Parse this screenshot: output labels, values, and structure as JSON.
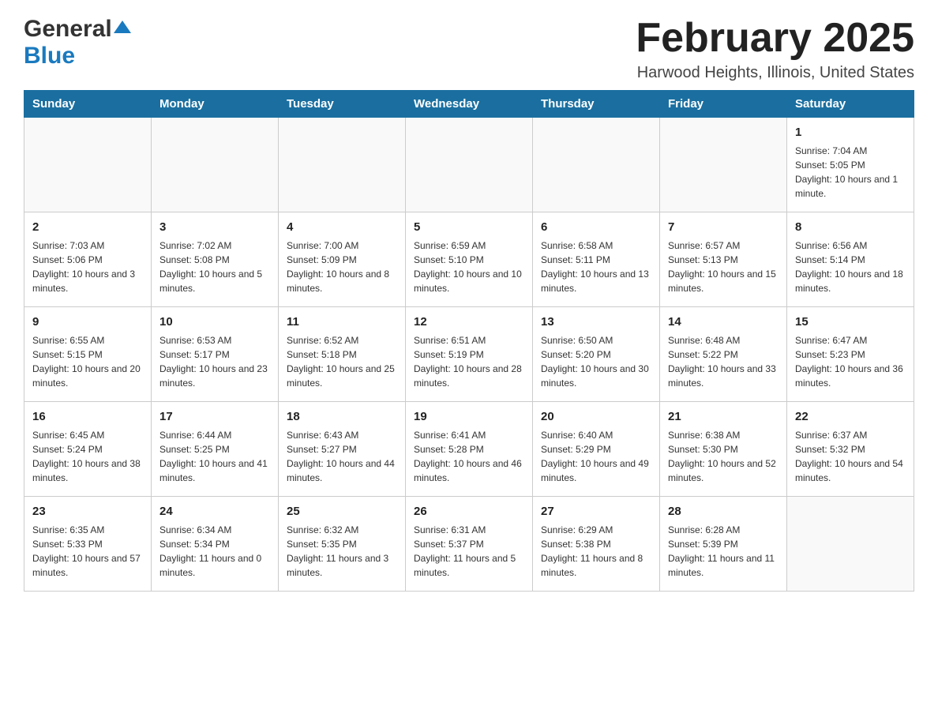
{
  "logo": {
    "general": "General",
    "blue": "Blue"
  },
  "header": {
    "title": "February 2025",
    "subtitle": "Harwood Heights, Illinois, United States"
  },
  "days_of_week": [
    "Sunday",
    "Monday",
    "Tuesday",
    "Wednesday",
    "Thursday",
    "Friday",
    "Saturday"
  ],
  "weeks": [
    [
      {
        "day": "",
        "info": ""
      },
      {
        "day": "",
        "info": ""
      },
      {
        "day": "",
        "info": ""
      },
      {
        "day": "",
        "info": ""
      },
      {
        "day": "",
        "info": ""
      },
      {
        "day": "",
        "info": ""
      },
      {
        "day": "1",
        "info": "Sunrise: 7:04 AM\nSunset: 5:05 PM\nDaylight: 10 hours and 1 minute."
      }
    ],
    [
      {
        "day": "2",
        "info": "Sunrise: 7:03 AM\nSunset: 5:06 PM\nDaylight: 10 hours and 3 minutes."
      },
      {
        "day": "3",
        "info": "Sunrise: 7:02 AM\nSunset: 5:08 PM\nDaylight: 10 hours and 5 minutes."
      },
      {
        "day": "4",
        "info": "Sunrise: 7:00 AM\nSunset: 5:09 PM\nDaylight: 10 hours and 8 minutes."
      },
      {
        "day": "5",
        "info": "Sunrise: 6:59 AM\nSunset: 5:10 PM\nDaylight: 10 hours and 10 minutes."
      },
      {
        "day": "6",
        "info": "Sunrise: 6:58 AM\nSunset: 5:11 PM\nDaylight: 10 hours and 13 minutes."
      },
      {
        "day": "7",
        "info": "Sunrise: 6:57 AM\nSunset: 5:13 PM\nDaylight: 10 hours and 15 minutes."
      },
      {
        "day": "8",
        "info": "Sunrise: 6:56 AM\nSunset: 5:14 PM\nDaylight: 10 hours and 18 minutes."
      }
    ],
    [
      {
        "day": "9",
        "info": "Sunrise: 6:55 AM\nSunset: 5:15 PM\nDaylight: 10 hours and 20 minutes."
      },
      {
        "day": "10",
        "info": "Sunrise: 6:53 AM\nSunset: 5:17 PM\nDaylight: 10 hours and 23 minutes."
      },
      {
        "day": "11",
        "info": "Sunrise: 6:52 AM\nSunset: 5:18 PM\nDaylight: 10 hours and 25 minutes."
      },
      {
        "day": "12",
        "info": "Sunrise: 6:51 AM\nSunset: 5:19 PM\nDaylight: 10 hours and 28 minutes."
      },
      {
        "day": "13",
        "info": "Sunrise: 6:50 AM\nSunset: 5:20 PM\nDaylight: 10 hours and 30 minutes."
      },
      {
        "day": "14",
        "info": "Sunrise: 6:48 AM\nSunset: 5:22 PM\nDaylight: 10 hours and 33 minutes."
      },
      {
        "day": "15",
        "info": "Sunrise: 6:47 AM\nSunset: 5:23 PM\nDaylight: 10 hours and 36 minutes."
      }
    ],
    [
      {
        "day": "16",
        "info": "Sunrise: 6:45 AM\nSunset: 5:24 PM\nDaylight: 10 hours and 38 minutes."
      },
      {
        "day": "17",
        "info": "Sunrise: 6:44 AM\nSunset: 5:25 PM\nDaylight: 10 hours and 41 minutes."
      },
      {
        "day": "18",
        "info": "Sunrise: 6:43 AM\nSunset: 5:27 PM\nDaylight: 10 hours and 44 minutes."
      },
      {
        "day": "19",
        "info": "Sunrise: 6:41 AM\nSunset: 5:28 PM\nDaylight: 10 hours and 46 minutes."
      },
      {
        "day": "20",
        "info": "Sunrise: 6:40 AM\nSunset: 5:29 PM\nDaylight: 10 hours and 49 minutes."
      },
      {
        "day": "21",
        "info": "Sunrise: 6:38 AM\nSunset: 5:30 PM\nDaylight: 10 hours and 52 minutes."
      },
      {
        "day": "22",
        "info": "Sunrise: 6:37 AM\nSunset: 5:32 PM\nDaylight: 10 hours and 54 minutes."
      }
    ],
    [
      {
        "day": "23",
        "info": "Sunrise: 6:35 AM\nSunset: 5:33 PM\nDaylight: 10 hours and 57 minutes."
      },
      {
        "day": "24",
        "info": "Sunrise: 6:34 AM\nSunset: 5:34 PM\nDaylight: 11 hours and 0 minutes."
      },
      {
        "day": "25",
        "info": "Sunrise: 6:32 AM\nSunset: 5:35 PM\nDaylight: 11 hours and 3 minutes."
      },
      {
        "day": "26",
        "info": "Sunrise: 6:31 AM\nSunset: 5:37 PM\nDaylight: 11 hours and 5 minutes."
      },
      {
        "day": "27",
        "info": "Sunrise: 6:29 AM\nSunset: 5:38 PM\nDaylight: 11 hours and 8 minutes."
      },
      {
        "day": "28",
        "info": "Sunrise: 6:28 AM\nSunset: 5:39 PM\nDaylight: 11 hours and 11 minutes."
      },
      {
        "day": "",
        "info": ""
      }
    ]
  ]
}
